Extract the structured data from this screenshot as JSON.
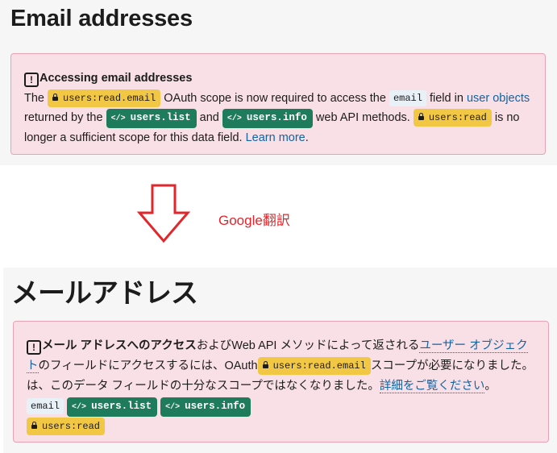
{
  "en": {
    "title": "Email addresses",
    "alert": {
      "heading": "Accessing email addresses",
      "t1": "The ",
      "scope_read_email": "users:read.email",
      "t2": " OAuth scope is now required to access the ",
      "field_email": "email",
      "t3": " field in ",
      "link_user_objects": "user objects",
      "t4": " returned by the ",
      "method_list": "users.list",
      "t5": " and ",
      "method_info": "users.info",
      "t6": " web API methods. ",
      "scope_read": "users:read",
      "t7": " is no longer a sufficient scope for this data field. ",
      "link_learn_more": "Learn more",
      "t8": "."
    }
  },
  "translate_label": "Google翻訳",
  "ja": {
    "title": "メールアドレス",
    "alert": {
      "heading": "メール アドレスへのアクセス",
      "t1": "およびWeb API メソッドによって返される",
      "link_user_objects": "ユーザー オブジェクト",
      "t2": "のフィールドにアクセスするには、OAuth",
      "scope_read_email": "users:read.email",
      "t3": "スコープが必要になりました。は、このデータ フィールドの十分なスコープではなくなりました。",
      "link_details": "詳細をご覧ください",
      "t4": "。 ",
      "field_email": "email",
      "method_list": "users.list",
      "method_info": "users.info",
      "scope_read": "users:read"
    }
  },
  "colors": {
    "alert_bg": "#f8e0e6",
    "alert_border": "#e8a2b3",
    "scope_bg": "#f2c744",
    "method_bg": "#1e7b5b",
    "link": "#1264a3",
    "arrow": "#e3262b"
  }
}
